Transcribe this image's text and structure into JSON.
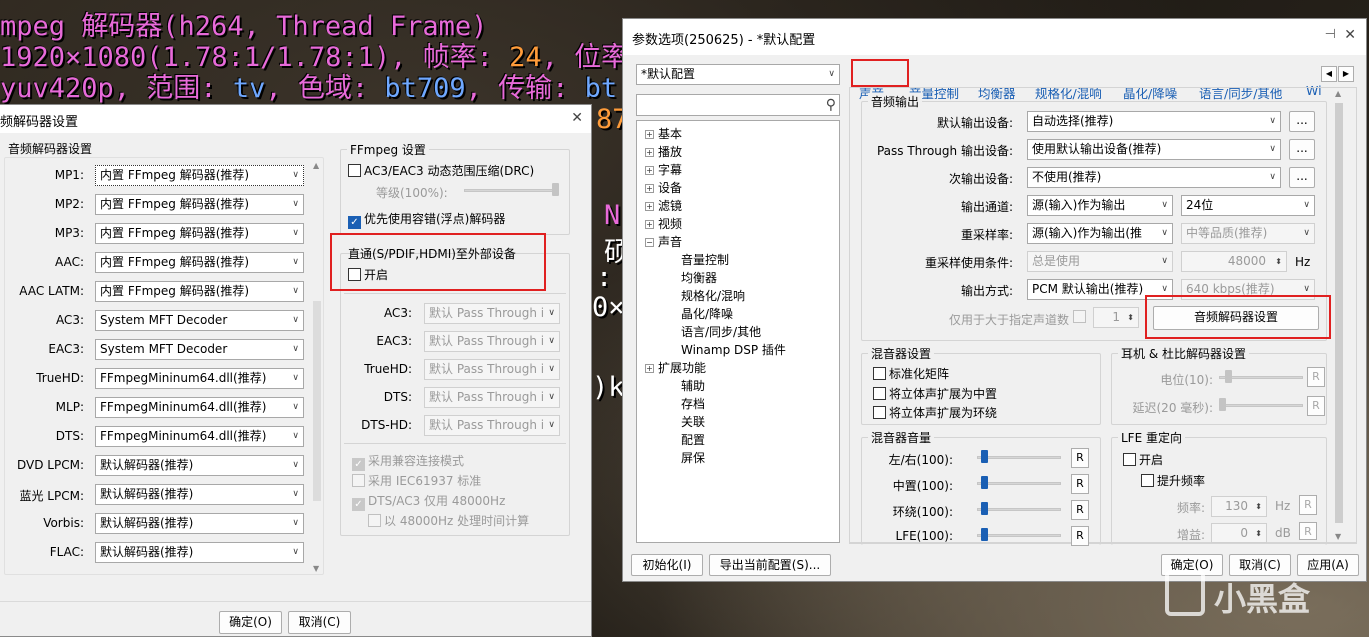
{
  "osd": {
    "line1": "mpeg 解码器(h264, Thread Frame)",
    "line2_a": "1920×1080(1.78:1/1.78:1), 帧率: ",
    "line2_fps": "24",
    "line2_b": ", 位率",
    "line3_a": "yuv420p, 范围: ",
    "line3_range": "tv",
    "line3_b": ", 色域: ",
    "line3_gamut": "bt709",
    "line3_c": ", 传输: ",
    "line3_trans": "bt",
    "frag_87": "87",
    "frag_N": "N",
    "frag_bo": "硕",
    "frag_colon": ":",
    "frag_0x": "0×",
    "frag_k": ")k"
  },
  "decoder_window": {
    "title": "频解码器设置",
    "close": "✕",
    "group_title": "音频解码器设置",
    "rows": [
      {
        "label": "MP1:",
        "value": "内置 FFmpeg 解码器(推荐)"
      },
      {
        "label": "MP2:",
        "value": "内置 FFmpeg 解码器(推荐)"
      },
      {
        "label": "MP3:",
        "value": "内置 FFmpeg 解码器(推荐)"
      },
      {
        "label": "AAC:",
        "value": "内置 FFmpeg 解码器(推荐)"
      },
      {
        "label": "AAC LATM:",
        "value": "内置 FFmpeg 解码器(推荐)"
      },
      {
        "label": "AC3:",
        "value": "System MFT Decoder"
      },
      {
        "label": "EAC3:",
        "value": "System MFT Decoder"
      },
      {
        "label": "TrueHD:",
        "value": "FFmpegMininum64.dll(推荐)"
      },
      {
        "label": "MLP:",
        "value": "FFmpegMininum64.dll(推荐)"
      },
      {
        "label": "DTS:",
        "value": "FFmpegMininum64.dll(推荐)"
      },
      {
        "label": "DVD LPCM:",
        "value": "默认解码器(推荐)"
      },
      {
        "label": "蓝光 LPCM:",
        "value": "默认解码器(推荐)"
      },
      {
        "label": "Vorbis:",
        "value": "默认解码器(推荐)"
      },
      {
        "label": "FLAC:",
        "value": "默认解码器(推荐)"
      }
    ],
    "ffmpeg": {
      "title": "FFmpeg 设置",
      "drc": "AC3/EAC3 动态范围压缩(DRC)",
      "level": "等级(100%):",
      "prefer_float": "优先使用容错(浮点)解码器"
    },
    "passthrough": {
      "title": "直通(S/PDIF,HDMI)至外部设备",
      "enable": "开启",
      "rows": [
        {
          "label": "AC3:",
          "value": "默认 Pass Through i"
        },
        {
          "label": "EAC3:",
          "value": "默认 Pass Through i"
        },
        {
          "label": "TrueHD:",
          "value": "默认 Pass Through i"
        },
        {
          "label": "DTS:",
          "value": "默认 Pass Through i"
        },
        {
          "label": "DTS-HD:",
          "value": "默认 Pass Through i"
        }
      ],
      "compat": "采用兼容连接模式",
      "iec": "采用 IEC61937 标准",
      "dts48": "DTS/AC3 仅用 48000Hz",
      "calc48": "以 48000Hz 处理时间计算"
    },
    "ok": "确定(O)",
    "cancel": "取消(C)"
  },
  "options_window": {
    "title": "参数选项(250625) - *默认配置",
    "profile": "*默认配置",
    "tabs": [
      "声音",
      "音量控制",
      "均衡器",
      "规格化/混响",
      "晶化/降噪",
      "语言/同步/其他",
      "Wi"
    ],
    "tree": [
      {
        "label": "基本",
        "exp": "+"
      },
      {
        "label": "播放",
        "exp": "+"
      },
      {
        "label": "字幕",
        "exp": "+"
      },
      {
        "label": "设备",
        "exp": "+"
      },
      {
        "label": "滤镜",
        "exp": "+"
      },
      {
        "label": "视频",
        "exp": "+"
      },
      {
        "label": "声音",
        "exp": "−"
      },
      {
        "label": "音量控制",
        "exp": ""
      },
      {
        "label": "均衡器",
        "exp": ""
      },
      {
        "label": "规格化/混响",
        "exp": ""
      },
      {
        "label": "晶化/降噪",
        "exp": ""
      },
      {
        "label": "语言/同步/其他",
        "exp": ""
      },
      {
        "label": "Winamp DSP 插件",
        "exp": ""
      },
      {
        "label": "扩展功能",
        "exp": "+"
      },
      {
        "label": "辅助",
        "exp": ""
      },
      {
        "label": "存档",
        "exp": ""
      },
      {
        "label": "关联",
        "exp": ""
      },
      {
        "label": "配置",
        "exp": ""
      },
      {
        "label": "屏保",
        "exp": ""
      }
    ],
    "audio_output": {
      "title": "音频输出",
      "default_device_label": "默认输出设备:",
      "default_device": "自动选择(推荐)",
      "passthrough_label": "Pass Through 输出设备:",
      "passthrough_device": "使用默认输出设备(推荐)",
      "secondary_label": "次输出设备:",
      "secondary_device": "不使用(推荐)",
      "channel_label": "输出通道:",
      "channel": "源(输入)作为输出",
      "bits": "24位",
      "resample_label": "重采样率:",
      "resample": "源(输入)作为输出(推",
      "quality": "中等品质(推荐)",
      "resample_cond_label": "重采样使用条件:",
      "resample_cond": "总是使用",
      "hz_value": "48000",
      "hz_unit": "Hz",
      "output_mode_label": "输出方式:",
      "output_mode": "PCM 默认输出(推荐)",
      "bitrate": "640 kbps(推荐)",
      "only_greater": "仅用于大于指定声道数",
      "channel_count": "1",
      "decoder_button": "音频解码器设置",
      "ellipsis": "..."
    },
    "mixer": {
      "title": "混音器设置",
      "normalize": "标准化矩阵",
      "center": "将立体声扩展为中置",
      "surround": "将立体声扩展为环绕"
    },
    "headphone": {
      "title": "耳机 & 杜比解码器设置",
      "level": "电位(10):",
      "delay": "延迟(20 毫秒):"
    },
    "mixer_volume": {
      "title": "混音器音量",
      "rows": [
        {
          "label": "左/右(100):",
          "level": 0.05
        },
        {
          "label": "中置(100):",
          "level": 0.05
        },
        {
          "label": "环绕(100):",
          "level": 0.05
        },
        {
          "label": "LFE(100):",
          "level": 0.05
        }
      ]
    },
    "lfe": {
      "title": "LFE 重定向",
      "enable": "开启",
      "boost": "提升频率",
      "freq_label": "频率:",
      "freq": "130",
      "freq_unit": "Hz",
      "gain_label": "增益:",
      "gain": "0",
      "gain_unit": "dB"
    },
    "reset_button": "初始化(I)",
    "export_button": "导出当前配置(S)...",
    "ok": "确定(O)",
    "cancel": "取消(C)",
    "apply": "应用(A)"
  },
  "watermark": "小黑盒",
  "colors": {
    "accent": "#1a5fb4",
    "highlight_box": "#e02020"
  }
}
